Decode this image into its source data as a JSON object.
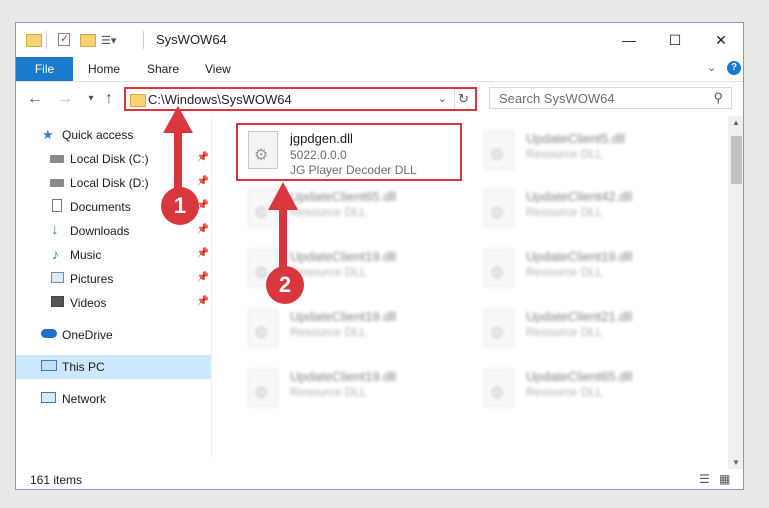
{
  "window": {
    "title": "SysWOW64",
    "min_icon": "minimize-icon",
    "max_icon": "maximize-icon",
    "close_icon": "close-icon"
  },
  "ribbon": {
    "file": "File",
    "home": "Home",
    "share": "Share",
    "view": "View"
  },
  "address": {
    "path": "C:\\Windows\\SysWOW64",
    "search_placeholder": "Search SysWOW64"
  },
  "sidebar": {
    "quick_access": "Quick access",
    "items": [
      {
        "label": "Local Disk (C:)",
        "icon": "drive-icon"
      },
      {
        "label": "Local Disk (D:)",
        "icon": "drive-icon"
      },
      {
        "label": "Documents",
        "icon": "documents-icon"
      },
      {
        "label": "Downloads",
        "icon": "downloads-icon"
      },
      {
        "label": "Music",
        "icon": "music-icon"
      },
      {
        "label": "Pictures",
        "icon": "pictures-icon"
      },
      {
        "label": "Videos",
        "icon": "videos-icon"
      }
    ],
    "onedrive": "OneDrive",
    "this_pc": "This PC",
    "network": "Network"
  },
  "files": [
    {
      "name": "jgpdgen.dll",
      "version": "5022.0.0.0",
      "desc": "JG Player Decoder DLL"
    },
    {
      "name": "UpdateClient5.dll",
      "version": "",
      "desc": "Resource DLL"
    },
    {
      "name": "UpdateClient65.dll",
      "version": "",
      "desc": "Resource DLL"
    },
    {
      "name": "UpdateClient42.dll",
      "version": "",
      "desc": "Resource DLL"
    },
    {
      "name": "UpdateClient19.dll",
      "version": "",
      "desc": "Resource DLL"
    },
    {
      "name": "UpdateClient19.dll",
      "version": "",
      "desc": "Resource DLL"
    },
    {
      "name": "UpdateClient19.dll",
      "version": "",
      "desc": "Resource DLL"
    },
    {
      "name": "UpdateClient21.dll",
      "version": "",
      "desc": "Resource DLL"
    },
    {
      "name": "UpdateClient19.dll",
      "version": "",
      "desc": "Resource DLL"
    },
    {
      "name": "UpdateClient65.dll",
      "version": "",
      "desc": "Resource DLL"
    }
  ],
  "status": {
    "count": "161 items"
  },
  "annotations": {
    "step1": "1",
    "step2": "2"
  },
  "colors": {
    "accent": "#1979ca",
    "highlight": "#d9363e",
    "selected": "#cce8ff"
  }
}
